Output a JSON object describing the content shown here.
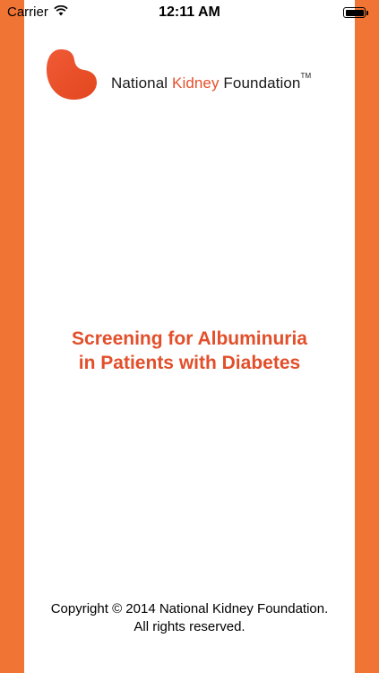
{
  "status_bar": {
    "carrier": "Carrier",
    "wifi_icon": "wifi-icon",
    "time": "12:11 AM",
    "battery_icon": "battery-full-icon"
  },
  "logo": {
    "word_national": "National ",
    "word_kidney": "Kidney",
    "word_foundation": " Foundation",
    "trademark": "TM",
    "icon": "kidney-logo-icon"
  },
  "splash": {
    "title_line1": "Screening for Albuminuria",
    "title_line2": "in Patients with Diabetes"
  },
  "footer": {
    "copyright_line1": "Copyright © 2014 National Kidney Foundation.",
    "copyright_line2": "All rights reserved."
  },
  "colors": {
    "side_bar": "#f07434",
    "brand_orange": "#e24f2a",
    "background": "#ffffff"
  }
}
